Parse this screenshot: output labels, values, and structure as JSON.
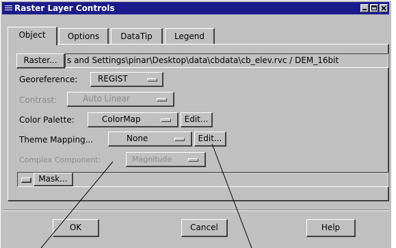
{
  "window": {
    "title": "Raster Layer Controls"
  },
  "tabs": [
    {
      "label": "Object",
      "active": true
    },
    {
      "label": "Options",
      "active": false
    },
    {
      "label": "DataTip",
      "active": false
    },
    {
      "label": "Legend",
      "active": false
    }
  ],
  "object": {
    "raster_button": "Raster...",
    "raster_path": "s and Settings\\pinar\\Desktop\\data\\cbdata\\cb_elev.rvc / DEM_16bit",
    "georeference_label": "Georeference:",
    "georeference_value": "REGIST",
    "contrast_label": "Contrast:",
    "contrast_value": "Auto Linear",
    "color_palette_label": "Color Palette:",
    "color_palette_value": "ColorMap",
    "color_palette_edit": "Edit...",
    "theme_mapping_label": "Theme Mapping...",
    "theme_mapping_value": "None",
    "theme_mapping_edit": "Edit...",
    "complex_component_label": "Complex Component:",
    "complex_component_value": "Magnitude",
    "mask_button": "Mask..."
  },
  "buttons": {
    "ok": "OK",
    "cancel": "Cancel",
    "help": "Help"
  },
  "colors": {
    "titlebar": "#1a1a8c",
    "face": "#c0c0c0",
    "shadow": "#404040",
    "highlight": "#ffffff"
  }
}
